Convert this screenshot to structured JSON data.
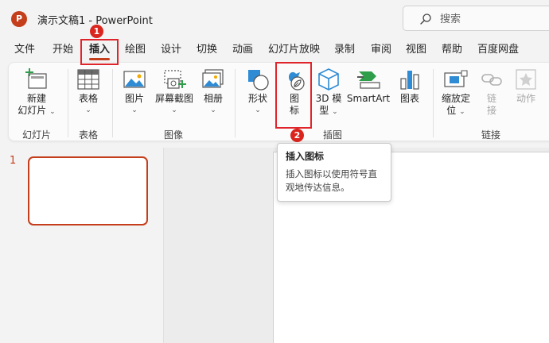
{
  "titlebar": {
    "app_logo": "P",
    "doc_title": "演示文稿1  -  PowerPoint",
    "search_placeholder": "搜索"
  },
  "tabs": [
    {
      "label": "文件",
      "active": false
    },
    {
      "label": "开始",
      "active": false
    },
    {
      "label": "插入",
      "active": true
    },
    {
      "label": "绘图",
      "active": false
    },
    {
      "label": "设计",
      "active": false
    },
    {
      "label": "切换",
      "active": false
    },
    {
      "label": "动画",
      "active": false
    },
    {
      "label": "幻灯片放映",
      "active": false
    },
    {
      "label": "录制",
      "active": false
    },
    {
      "label": "审阅",
      "active": false
    },
    {
      "label": "视图",
      "active": false
    },
    {
      "label": "帮助",
      "active": false
    },
    {
      "label": "百度网盘",
      "active": false
    }
  ],
  "ribbon": {
    "new_slide": {
      "line1": "新建",
      "line2": "幻灯片",
      "icon": "new-slide-icon"
    },
    "table": {
      "label": "表格",
      "icon": "table-icon"
    },
    "picture": {
      "label": "图片",
      "icon": "picture-icon"
    },
    "screenshot": {
      "label": "屏幕截图",
      "icon": "screenshot-icon"
    },
    "album": {
      "label": "相册",
      "icon": "photo-album-icon"
    },
    "shapes": {
      "label": "形状",
      "icon": "shapes-icon"
    },
    "icons": {
      "line1": "图",
      "line2": "标",
      "icon": "icons-icon"
    },
    "model3d": {
      "line1": "3D 模",
      "line2": "型",
      "icon": "3d-model-icon"
    },
    "smartart": {
      "label": "SmartArt",
      "icon": "smartart-icon"
    },
    "chart": {
      "label": "图表",
      "icon": "chart-icon"
    },
    "zoom": {
      "line1": "缩放定",
      "line2": "位",
      "icon": "zoom-icon"
    },
    "link": {
      "line1": "链",
      "line2": "接",
      "icon": "link-icon"
    },
    "action": {
      "label": "动作",
      "icon": "action-icon"
    },
    "groups": {
      "slides": "幻灯片",
      "tables": "表格",
      "images": "图像",
      "illustrations": "插图",
      "links": "链接"
    }
  },
  "callouts": {
    "badge1": "1",
    "badge2": "2"
  },
  "tooltip": {
    "title": "插入图标",
    "description": "插入图标以使用符号直观地传达信息。"
  },
  "slides_pane": {
    "slide_number": "1"
  },
  "colors": {
    "accent": "#c43e1c",
    "highlight": "#e0242b"
  }
}
